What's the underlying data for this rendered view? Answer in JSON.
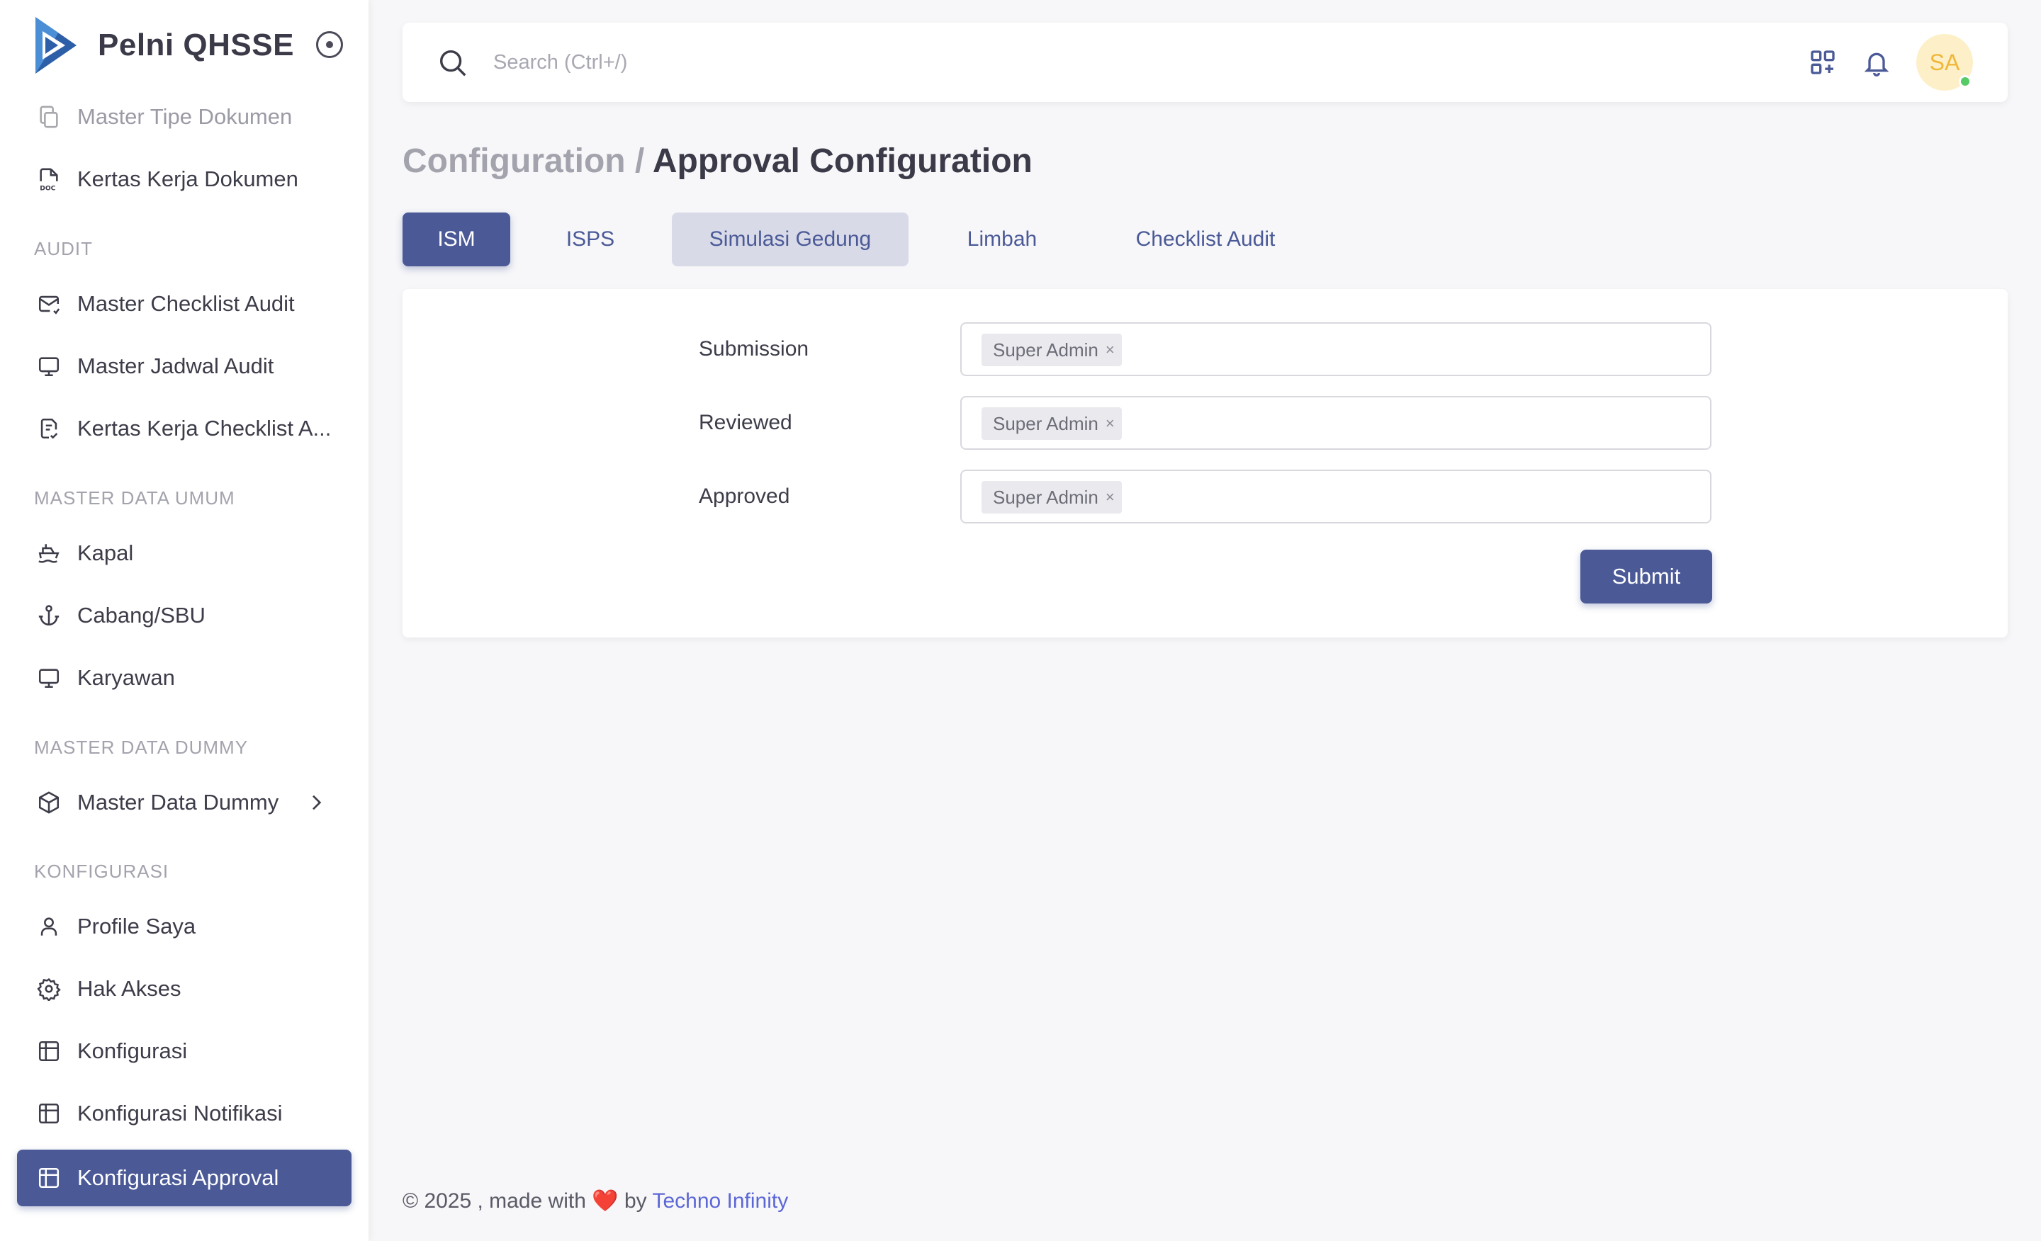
{
  "app": {
    "name": "Pelni QHSSE"
  },
  "sidebar": {
    "items": [
      {
        "label": "Master Tipe Dokumen",
        "icon": "copy-icon"
      },
      {
        "label": "Kertas Kerja Dokumen",
        "icon": "doc-file-icon"
      },
      {
        "label": "Master Checklist Audit",
        "icon": "mail-icon"
      },
      {
        "label": "Master Jadwal Audit",
        "icon": "monitor-icon"
      },
      {
        "label": "Kertas Kerja Checklist A...",
        "icon": "checklist-file-icon"
      },
      {
        "label": "Kapal",
        "icon": "ship-icon"
      },
      {
        "label": "Cabang/SBU",
        "icon": "anchor-icon"
      },
      {
        "label": "Karyawan",
        "icon": "monitor-icon"
      },
      {
        "label": "Master Data Dummy",
        "icon": "box-icon"
      },
      {
        "label": "Profile Saya",
        "icon": "user-icon"
      },
      {
        "label": "Hak Akses",
        "icon": "gear-icon"
      },
      {
        "label": "Konfigurasi",
        "icon": "table-icon"
      },
      {
        "label": "Konfigurasi Notifikasi",
        "icon": "table-icon"
      },
      {
        "label": "Konfigurasi Approval",
        "icon": "table-icon"
      }
    ],
    "sections": {
      "audit": "AUDIT",
      "master_data_umum": "MASTER DATA UMUM",
      "master_data_dummy": "MASTER DATA DUMMY",
      "konfigurasi": "KONFIGURASI"
    }
  },
  "topbar": {
    "search_placeholder": "Search (Ctrl+/)",
    "avatar_initials": "SA"
  },
  "page": {
    "breadcrumb_parent": "Configuration",
    "breadcrumb_sep": "/",
    "title": "Approval Configuration"
  },
  "tabs": [
    "ISM",
    "ISPS",
    "Simulasi Gedung",
    "Limbah",
    "Checklist Audit"
  ],
  "form": {
    "fields": [
      {
        "label": "Submission",
        "chip": "Super Admin"
      },
      {
        "label": "Reviewed",
        "chip": "Super Admin"
      },
      {
        "label": "Approved",
        "chip": "Super Admin"
      }
    ],
    "chip_remove": "×",
    "submit_label": "Submit"
  },
  "footer": {
    "prefix": "© 2025 , made with",
    "heart": "❤️",
    "by": "by",
    "link": "Techno Infinity"
  },
  "colors": {
    "primary": "#4b5a97",
    "tab_hover": "#d8dae8",
    "avatar_bg": "#fdf0c8",
    "avatar_text": "#f0b73a",
    "online": "#56ca64",
    "link": "#5c67d6"
  }
}
